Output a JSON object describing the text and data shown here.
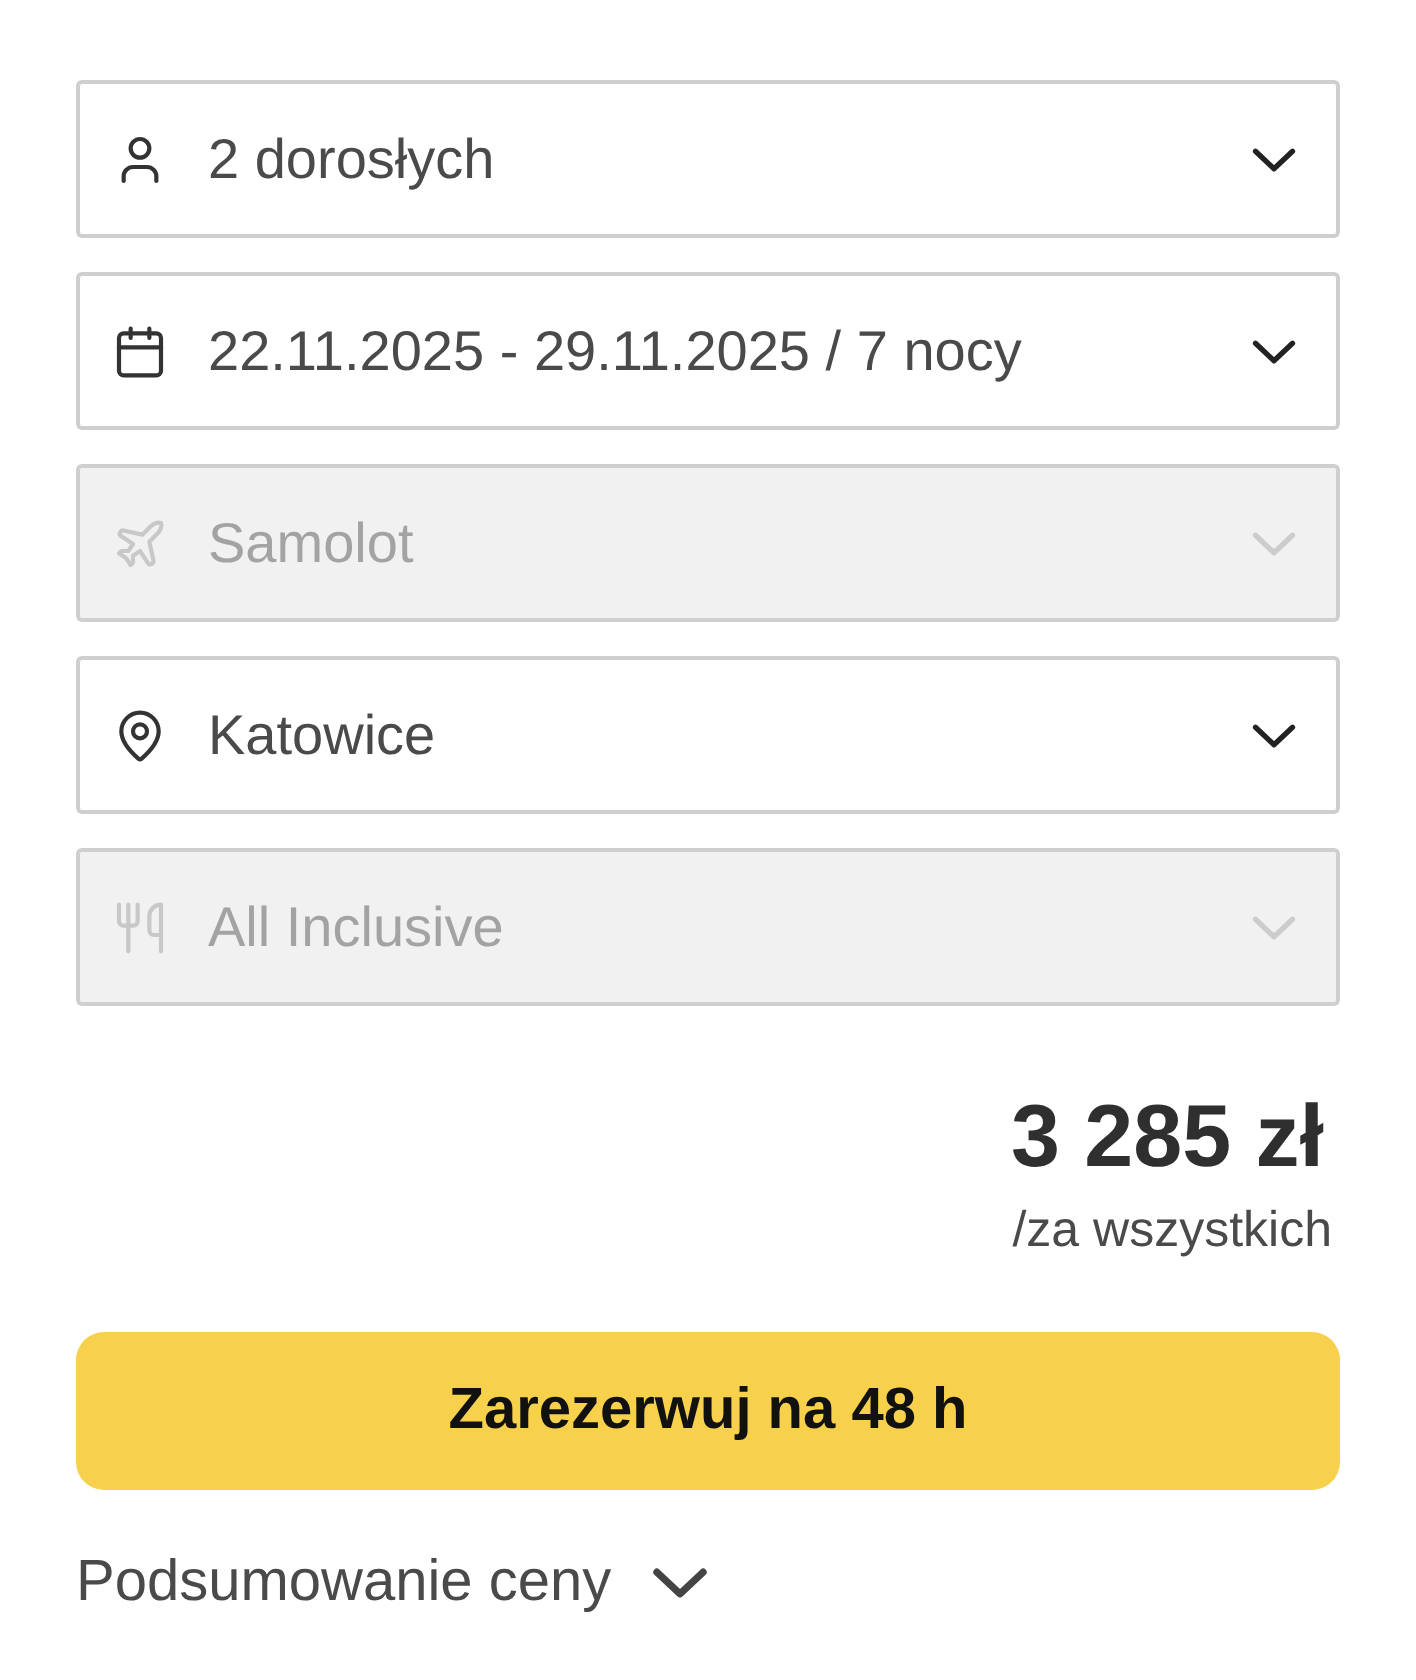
{
  "fields": [
    {
      "kind": "travelers",
      "value": "2 dorosłych",
      "disabled": false
    },
    {
      "kind": "dates",
      "value": "22.11.2025 - 29.11.2025 / 7 nocy",
      "disabled": false
    },
    {
      "kind": "transport",
      "value": "Samolot",
      "disabled": true
    },
    {
      "kind": "departure",
      "value": "Katowice",
      "disabled": false
    },
    {
      "kind": "board",
      "value": "All Inclusive",
      "disabled": true
    }
  ],
  "price": {
    "amount": "3 285 zł",
    "note": "/za wszystkich"
  },
  "reserve_button": {
    "label": "Zarezerwuj na 48 h"
  },
  "summary": {
    "label": "Podsumowanie ceny",
    "expanded": false
  }
}
